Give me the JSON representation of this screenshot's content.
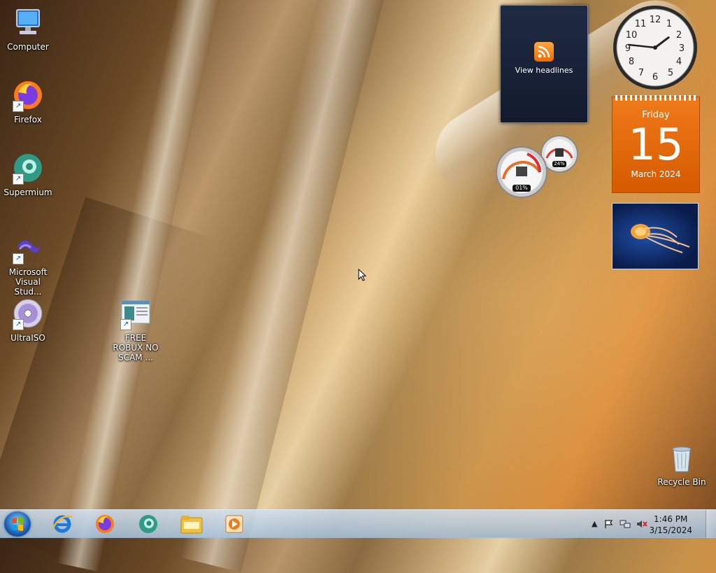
{
  "desktop": {
    "icons": [
      {
        "label": "Computer"
      },
      {
        "label": "Firefox"
      },
      {
        "label": "Supermium"
      },
      {
        "label": "Microsoft Visual Stud..."
      },
      {
        "label": "UltraISO"
      },
      {
        "label": "FREE ROBUX NO SCAM ..."
      },
      {
        "label": "Recycle Bin"
      }
    ]
  },
  "gadgets": {
    "feed": {
      "label": "View headlines"
    },
    "clock": {
      "hours": 1,
      "minutes": 46
    },
    "calendar": {
      "weekday": "Friday",
      "day": "15",
      "month_year": "March 2024"
    },
    "cpu_meter": {
      "cpu": "01%",
      "memory": "24%"
    }
  },
  "taskbar": {
    "pinned": [
      "internet-explorer",
      "firefox",
      "supermium",
      "file-explorer",
      "media-player"
    ],
    "tray": {
      "time": "1:46 PM",
      "date": "3/15/2024"
    }
  },
  "colors": {
    "calendar": "#e8690f",
    "taskbar": "#b4cce4"
  }
}
